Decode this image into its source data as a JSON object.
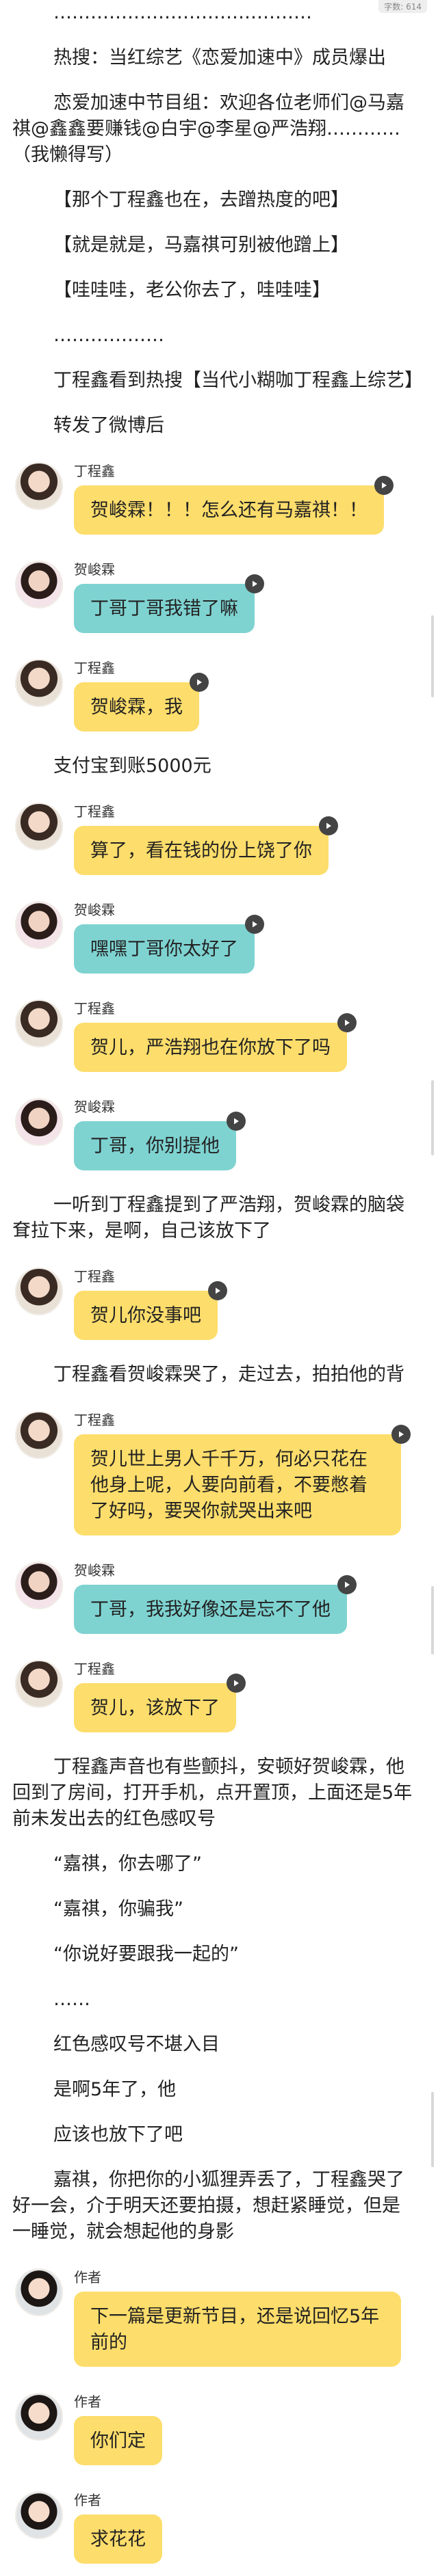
{
  "badge": "字数: 614",
  "feed": [
    {
      "kind": "text",
      "text": "……………………………………"
    },
    {
      "kind": "text",
      "text": "热搜：当红综艺《恋爱加速中》成员爆出"
    },
    {
      "kind": "text",
      "text": "恋爱加速中节目组：欢迎各位老师们@马嘉祺@鑫鑫要赚钱@白宇@李星@严浩翔…………（我懒得写）"
    },
    {
      "kind": "text",
      "text": "【那个丁程鑫也在，去蹭热度的吧】"
    },
    {
      "kind": "text",
      "text": "【就是就是，马嘉祺可别被他蹭上】"
    },
    {
      "kind": "text",
      "text": "【哇哇哇，老公你去了，哇哇哇】"
    },
    {
      "kind": "text",
      "text": "………………"
    },
    {
      "kind": "text",
      "text": "丁程鑫看到热搜【当代小糊咖丁程鑫上综艺】"
    },
    {
      "kind": "text",
      "text": "转发了微博后"
    },
    {
      "kind": "msg",
      "avatar": "ding",
      "name": "丁程鑫",
      "color": "yellow",
      "text": "贺峻霖！！！怎么还有马嘉祺！！"
    },
    {
      "kind": "msg",
      "avatar": "he",
      "name": "贺峻霖",
      "color": "teal",
      "text": "丁哥丁哥我错了嘛"
    },
    {
      "kind": "msg",
      "avatar": "ding",
      "name": "丁程鑫",
      "color": "yellow",
      "text": "贺峻霖，我"
    },
    {
      "kind": "text",
      "text": "支付宝到账5000元"
    },
    {
      "kind": "msg",
      "avatar": "ding",
      "name": "丁程鑫",
      "color": "yellow",
      "text": "算了，看在钱的份上饶了你"
    },
    {
      "kind": "msg",
      "avatar": "he",
      "name": "贺峻霖",
      "color": "teal",
      "text": "嘿嘿丁哥你太好了"
    },
    {
      "kind": "msg",
      "avatar": "ding",
      "name": "丁程鑫",
      "color": "yellow",
      "text": "贺儿，严浩翔也在你放下了吗"
    },
    {
      "kind": "msg",
      "avatar": "he",
      "name": "贺峻霖",
      "color": "teal",
      "text": "丁哥，你别提他"
    },
    {
      "kind": "text",
      "text": "一听到丁程鑫提到了严浩翔，贺峻霖的脑袋耷拉下来，是啊，自己该放下了"
    },
    {
      "kind": "msg",
      "avatar": "ding",
      "name": "丁程鑫",
      "color": "yellow",
      "text": "贺儿你没事吧"
    },
    {
      "kind": "text",
      "text": "丁程鑫看贺峻霖哭了，走过去，拍拍他的背"
    },
    {
      "kind": "msg",
      "avatar": "ding",
      "name": "丁程鑫",
      "color": "yellow",
      "text": "贺儿世上男人千千万，何必只花在他身上呢，人要向前看，不要憋着了好吗，要哭你就哭出来吧"
    },
    {
      "kind": "msg",
      "avatar": "he",
      "name": "贺峻霖",
      "color": "teal",
      "text": "丁哥，我我好像还是忘不了他"
    },
    {
      "kind": "msg",
      "avatar": "ding",
      "name": "丁程鑫",
      "color": "yellow",
      "text": "贺儿，该放下了"
    },
    {
      "kind": "text",
      "text": "丁程鑫声音也有些颤抖，安顿好贺峻霖，他回到了房间，打开手机，点开置顶，上面还是5年前未发出去的红色感叹号"
    },
    {
      "kind": "text",
      "text": "“嘉祺，你去哪了”"
    },
    {
      "kind": "text",
      "text": "“嘉祺，你骗我”"
    },
    {
      "kind": "text",
      "text": "“你说好要跟我一起的”"
    },
    {
      "kind": "text",
      "text": "……"
    },
    {
      "kind": "text",
      "text": "红色感叹号不堪入目"
    },
    {
      "kind": "text",
      "text": "是啊5年了，他"
    },
    {
      "kind": "text",
      "text": "应该也放下了吧"
    },
    {
      "kind": "text",
      "text": "嘉祺，你把你的小狐狸弄丢了，丁程鑫哭了好一会，介于明天还要拍摄，想赶紧睡觉，但是一睡觉，就会想起他的身影"
    },
    {
      "kind": "msg",
      "avatar": "author",
      "name": "作者",
      "color": "yellow",
      "text": "下一篇是更新节目，还是说回忆5年前的",
      "noplay": true
    },
    {
      "kind": "msg",
      "avatar": "author",
      "name": "作者",
      "color": "yellow",
      "text": "你们定",
      "noplay": true
    },
    {
      "kind": "msg",
      "avatar": "author",
      "name": "作者",
      "color": "yellow",
      "text": "求花花",
      "noplay": true
    }
  ]
}
